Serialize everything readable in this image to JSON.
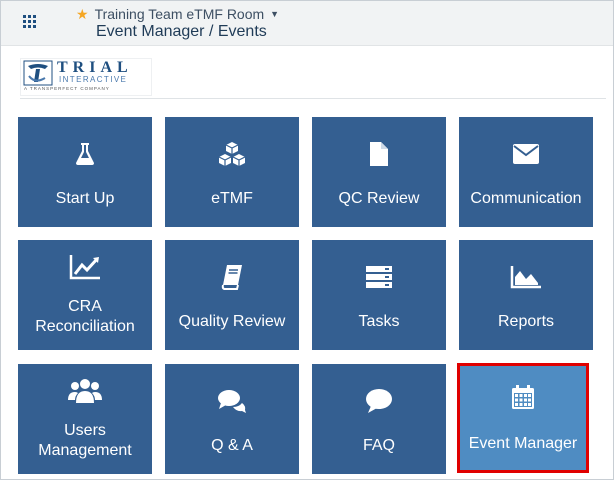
{
  "header": {
    "room_name": "Training Team eTMF Room",
    "breadcrumb": "Event Manager / Events",
    "icons": [
      "apps-grid-icon",
      "star-icon",
      "caret-down-icon"
    ]
  },
  "logo": {
    "name": "TRIAL",
    "sub": "INTERACTIVE",
    "tagline": "A TRANSPERFECT COMPANY"
  },
  "tiles": [
    {
      "label": "Start Up",
      "icon": "flask-icon"
    },
    {
      "label": "eTMF",
      "icon": "cubes-icon"
    },
    {
      "label": "QC Review",
      "icon": "file-icon"
    },
    {
      "label": "Communication",
      "icon": "envelope-icon"
    },
    {
      "label": "CRA Reconciliation",
      "icon": "line-chart-icon"
    },
    {
      "label": "Quality Review",
      "icon": "book-icon"
    },
    {
      "label": "Tasks",
      "icon": "server-icon"
    },
    {
      "label": "Reports",
      "icon": "area-chart-icon"
    },
    {
      "label": "Users Management",
      "icon": "users-icon"
    },
    {
      "label": "Q & A",
      "icon": "comments-icon"
    },
    {
      "label": "FAQ",
      "icon": "comment-icon"
    },
    {
      "label": "Event Manager",
      "icon": "calendar-icon",
      "selected": true
    }
  ],
  "colors": {
    "tile": "#345f91",
    "tile_selected": "#4f8cc2",
    "highlight_border": "#e00000",
    "star": "#f5a623"
  }
}
